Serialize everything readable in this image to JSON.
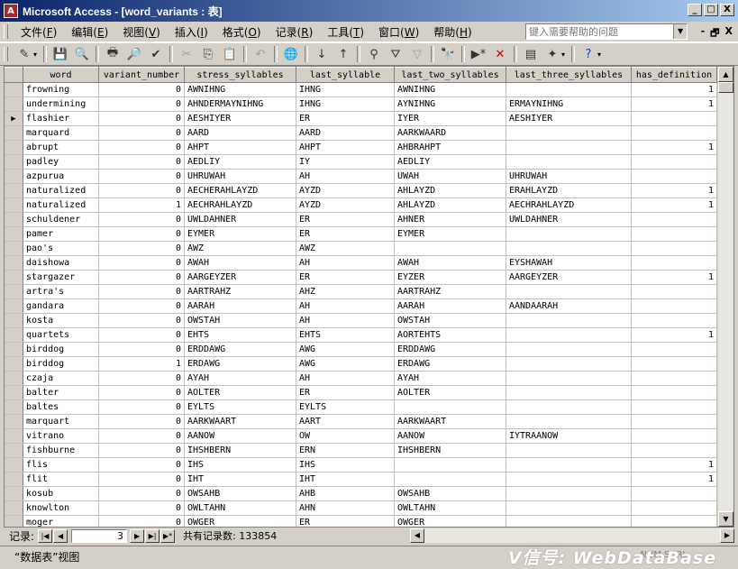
{
  "window": {
    "title": "Microsoft Access - [word_variants : 表]",
    "controls": [
      "_",
      "□",
      "X"
    ]
  },
  "menu": {
    "items": [
      {
        "label": "文件(",
        "key": "F",
        "end": ")"
      },
      {
        "label": "编辑(",
        "key": "E",
        "end": ")"
      },
      {
        "label": "视图(",
        "key": "V",
        "end": ")"
      },
      {
        "label": "插入(",
        "key": "I",
        "end": ")"
      },
      {
        "label": "格式(",
        "key": "O",
        "end": ")"
      },
      {
        "label": "记录(",
        "key": "R",
        "end": ")"
      },
      {
        "label": "工具(",
        "key": "T",
        "end": ")"
      },
      {
        "label": "窗口(",
        "key": "W",
        "end": ")"
      },
      {
        "label": "帮助(",
        "key": "H",
        "end": ")"
      }
    ],
    "help_placeholder": "键入需要帮助的问题",
    "mdi_controls": [
      "-",
      "🗗",
      "X"
    ]
  },
  "toolbar": {
    "icons": [
      "view-icon",
      "save-icon",
      "search-file-icon",
      "print-icon",
      "print-preview-icon",
      "spelling-icon",
      "cut-icon",
      "copy-icon",
      "paste-icon",
      "undo-icon",
      "hyperlink-icon",
      "sort-ascending-icon",
      "sort-descending-icon",
      "filter-by-selection-icon",
      "filter-by-form-icon",
      "apply-filter-icon",
      "find-icon",
      "new-record-icon",
      "delete-record-icon",
      "database-window-icon",
      "new-object-icon",
      "help-icon"
    ]
  },
  "table": {
    "columns": [
      "word",
      "variant_number",
      "stress_syllables",
      "last_syllable",
      "last_two_syllables",
      "last_three_syllables",
      "has_definition"
    ],
    "current_row_index": 2,
    "rows": [
      [
        "frowning",
        "0",
        "AWNIHNG",
        "IHNG",
        "AWNIHNG",
        "",
        "1"
      ],
      [
        "undermining",
        "0",
        "AHNDERMAYNIHNG",
        "IHNG",
        "AYNIHNG",
        "ERMAYNIHNG",
        "1"
      ],
      [
        "flashier",
        "0",
        "AESHIYER",
        "ER",
        "IYER",
        "AESHIYER",
        ""
      ],
      [
        "marquard",
        "0",
        "AARD",
        "AARD",
        "AARKWAARD",
        "",
        ""
      ],
      [
        "abrupt",
        "0",
        "AHPT",
        "AHPT",
        "AHBRAHPT",
        "",
        "1"
      ],
      [
        "padley",
        "0",
        "AEDLIY",
        "IY",
        "AEDLIY",
        "",
        ""
      ],
      [
        "azpurua",
        "0",
        "UHRUWAH",
        "AH",
        "UWAH",
        "UHRUWAH",
        ""
      ],
      [
        "naturalized",
        "0",
        "AECHERAHLAYZD",
        "AYZD",
        "AHLAYZD",
        "ERAHLAYZD",
        "1"
      ],
      [
        "naturalized",
        "1",
        "AECHRAHLAYZD",
        "AYZD",
        "AHLAYZD",
        "AECHRAHLAYZD",
        "1"
      ],
      [
        "schuldener",
        "0",
        "UWLDAHNER",
        "ER",
        "AHNER",
        "UWLDAHNER",
        ""
      ],
      [
        "pamer",
        "0",
        "EYMER",
        "ER",
        "EYMER",
        "",
        ""
      ],
      [
        "pao's",
        "0",
        "AWZ",
        "AWZ",
        "",
        "",
        ""
      ],
      [
        "daishowa",
        "0",
        "AWAH",
        "AH",
        "AWAH",
        "EYSHAWAH",
        ""
      ],
      [
        "stargazer",
        "0",
        "AARGEYZER",
        "ER",
        "EYZER",
        "AARGEYZER",
        "1"
      ],
      [
        "artra's",
        "0",
        "AARTRAHZ",
        "AHZ",
        "AARTRAHZ",
        "",
        ""
      ],
      [
        "gandara",
        "0",
        "AARAH",
        "AH",
        "AARAH",
        "AANDAARAH",
        ""
      ],
      [
        "kosta",
        "0",
        "OWSTAH",
        "AH",
        "OWSTAH",
        "",
        ""
      ],
      [
        "quartets",
        "0",
        "EHTS",
        "EHTS",
        "AORTEHTS",
        "",
        "1"
      ],
      [
        "birddog",
        "0",
        "ERDDAWG",
        "AWG",
        "ERDDAWG",
        "",
        ""
      ],
      [
        "birddog",
        "1",
        "ERDAWG",
        "AWG",
        "ERDAWG",
        "",
        ""
      ],
      [
        "czaja",
        "0",
        "AYAH",
        "AH",
        "AYAH",
        "",
        ""
      ],
      [
        "balter",
        "0",
        "AOLTER",
        "ER",
        "AOLTER",
        "",
        ""
      ],
      [
        "baltes",
        "0",
        "EYLTS",
        "EYLTS",
        "",
        "",
        ""
      ],
      [
        "marquart",
        "0",
        "AARKWAART",
        "AART",
        "AARKWAART",
        "",
        ""
      ],
      [
        "vitrano",
        "0",
        "AANOW",
        "OW",
        "AANOW",
        "IYTRAANOW",
        ""
      ],
      [
        "fishburne",
        "0",
        "IHSHBERN",
        "ERN",
        "IHSHBERN",
        "",
        ""
      ],
      [
        "flis",
        "0",
        "IHS",
        "IHS",
        "",
        "",
        "1"
      ],
      [
        "flit",
        "0",
        "IHT",
        "IHT",
        "",
        "",
        "1"
      ],
      [
        "kosub",
        "0",
        "OWSAHB",
        "AHB",
        "OWSAHB",
        "",
        ""
      ],
      [
        "knowlton",
        "0",
        "OWLTAHN",
        "AHN",
        "OWLTAHN",
        "",
        ""
      ],
      [
        "moger",
        "0",
        "OWGER",
        "ER",
        "OWGER",
        "",
        ""
      ]
    ]
  },
  "navigator": {
    "label": "记录:",
    "current_record": "3",
    "total_label": "共有记录数: 133854",
    "buttons": [
      "|◀",
      "◀",
      "▶",
      "▶|",
      "▶*"
    ]
  },
  "status": {
    "view_label": "“数据表”视图",
    "indicator": "NUM SCRL",
    "watermark": "V信号: WebDataBase"
  }
}
